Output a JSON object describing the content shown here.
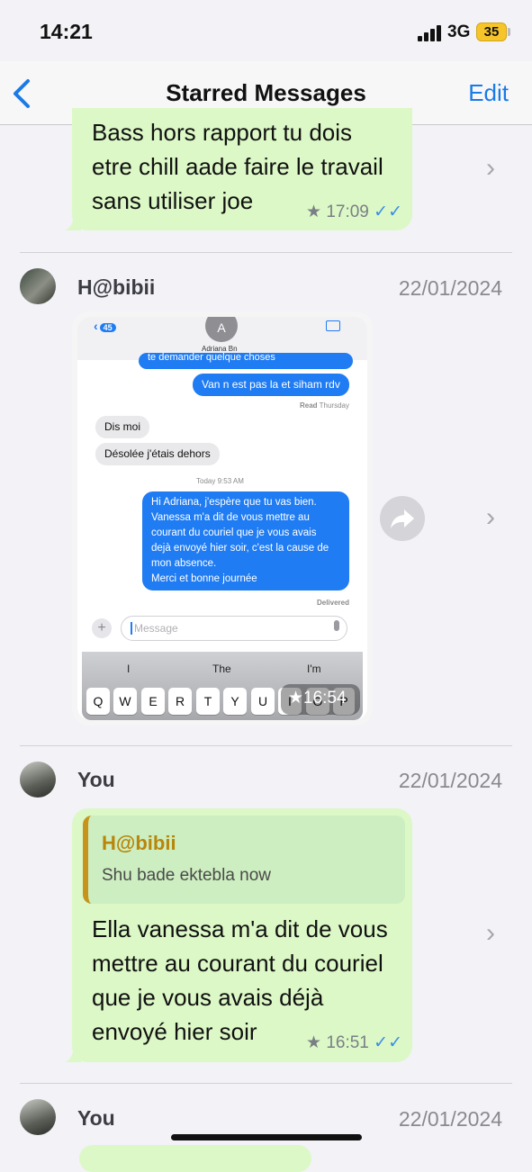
{
  "status_bar": {
    "time": "14:21",
    "network": "3G",
    "battery": "35"
  },
  "nav": {
    "title": "Starred Messages",
    "edit_label": "Edit"
  },
  "messages": [
    {
      "text": "Bass hors rapport tu dois etre chill aade faire le travail sans utiliser joe",
      "lines": [
        "Bass hors rapport tu dois",
        "etre chill aade faire le travail",
        "sans utiliser joe"
      ],
      "time": "17:09"
    },
    {
      "sender": "H@bibii",
      "date": "22/01/2024",
      "time": "16:54",
      "image": {
        "contact_name": "Adriana Bn",
        "back_badge": "45",
        "avatar_initial": "A",
        "cut_text": "te demander quelque choses",
        "sent_1": "Van n est pas la et siham rdv",
        "read_label": "Read",
        "read_day": "Thursday",
        "recv_1": "Dis moi",
        "recv_2": "Désolée j'étais dehors",
        "today_label": "Today 9:53 AM",
        "sent_2_lines": [
          "Hi Adriana, j'espère que tu vas bien.",
          "Vanessa m'a dit de vous mettre au",
          "courant du couriel que je vous avais",
          "dejà envoyé hier soir, c'est la cause de",
          "mon absence.",
          "Merci et bonne journée"
        ],
        "delivered_label": "Delivered",
        "input_placeholder": "Message",
        "suggestions": [
          "I",
          "The",
          "I'm"
        ],
        "keys": [
          "Q",
          "W",
          "E",
          "R",
          "T",
          "Y",
          "U",
          "I",
          "O",
          "P"
        ]
      }
    },
    {
      "sender": "You",
      "date": "22/01/2024",
      "quote_sender": "H@bibii",
      "quote_text": "Shu bade ektebla now",
      "lines": [
        "Ella vanessa m'a dit de vous",
        "mettre au courant du couriel",
        "que je vous avais déjà",
        "envoyé hier soir"
      ],
      "time": "16:51"
    },
    {
      "sender": "You",
      "date": "22/01/2024"
    }
  ],
  "colors": {
    "accent": "#1a7ae6",
    "bubble": "#dcf8c6",
    "quote_bar": "#c7941b",
    "quote_name": "#b8860b"
  }
}
